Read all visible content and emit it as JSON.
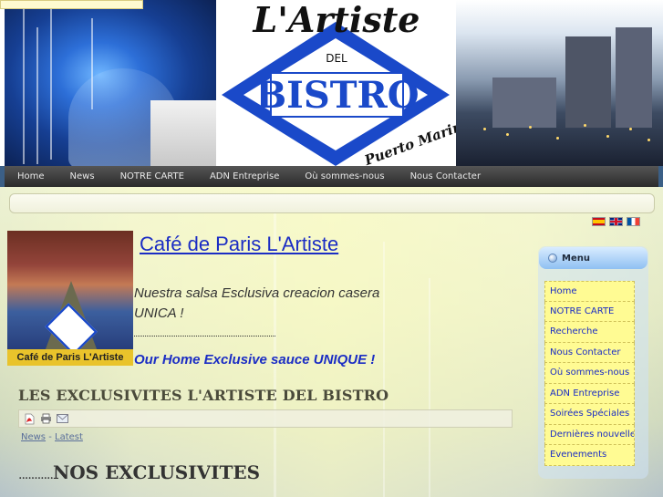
{
  "logo": {
    "line1": "L'Artiste",
    "line2": "DEL",
    "line3": "BISTRO",
    "line4": "Puerto Marina"
  },
  "nav": {
    "items": [
      "Home",
      "News",
      "NOTRE CARTE",
      "ADN Entreprise",
      "Où sommes-nous",
      "Nous Contacter"
    ]
  },
  "languages": [
    "es-flag",
    "gb-flag",
    "fr-flag"
  ],
  "article": {
    "image_caption": "Café de Paris L'Artiste",
    "title": "Café de Paris L'Artiste",
    "text1": "Nuestra salsa Esclusiva creacion casera UNICA !",
    "text2": "Our Home Exclusive sauce UNIQUE !",
    "section_title": "LES EXCLUSIVITES L'ARTISTE DEL BISTRO",
    "breadcrumb": {
      "first": "News",
      "sep": " - ",
      "second": "Latest"
    },
    "sub_title": "NOS EXCLUSIVITES",
    "sub_title_prefix": "..........."
  },
  "icons": {
    "pdf": "pdf-icon",
    "print": "print-icon",
    "email": "email-icon"
  },
  "menu": {
    "title": "Menu",
    "items": [
      "Home",
      "NOTRE CARTE",
      "Recherche",
      "Nous Contacter",
      "Où sommes-nous",
      "ADN Entreprise",
      "Soirées Spéciales",
      "Dernières nouvelles",
      "Evenements"
    ]
  },
  "colors": {
    "link": "#1b2dc4",
    "nav_bg": "#2b2b2b",
    "menu_item_bg": "#fffb93",
    "logo_blue": "#1a49c9"
  }
}
